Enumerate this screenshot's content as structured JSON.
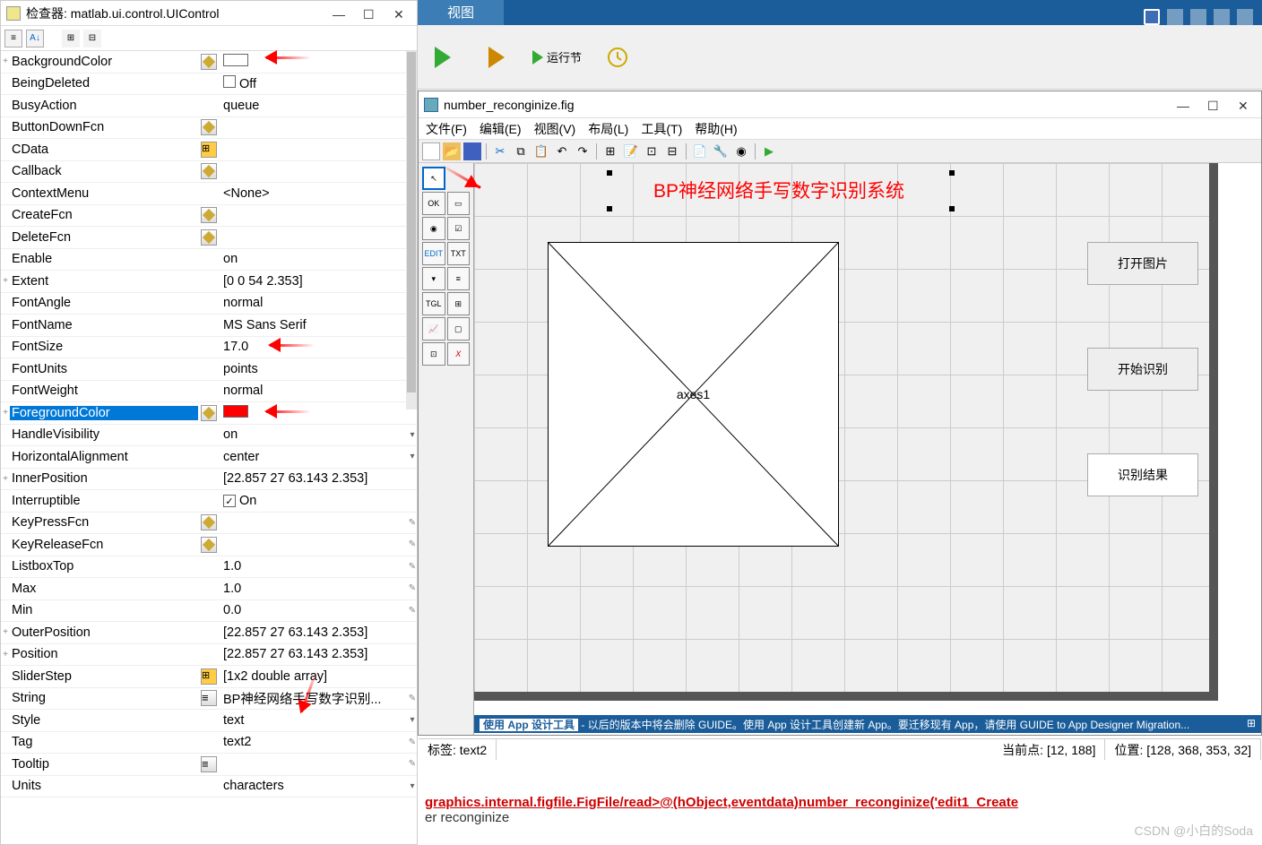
{
  "inspector": {
    "title": "检查器: matlab.ui.control.UIControl",
    "props": [
      {
        "exp": "+",
        "name": "BackgroundColor",
        "btn": "pencil",
        "val_type": "swatch-white"
      },
      {
        "name": "BeingDeleted",
        "val_type": "chk",
        "val": "Off"
      },
      {
        "name": "BusyAction",
        "val": "queue",
        "dd": true
      },
      {
        "name": "ButtonDownFcn",
        "btn": "pencil",
        "val": "",
        "edit": true
      },
      {
        "name": "CData",
        "btn": "grid",
        "val": "",
        "edit": true
      },
      {
        "name": "Callback",
        "btn": "pencil",
        "val": "",
        "edit": true
      },
      {
        "name": "ContextMenu",
        "val": "<None>",
        "dd": true
      },
      {
        "name": "CreateFcn",
        "btn": "pencil",
        "val": "",
        "edit": true
      },
      {
        "name": "DeleteFcn",
        "btn": "pencil",
        "val": "",
        "edit": true
      },
      {
        "name": "Enable",
        "val": "on",
        "dd": true
      },
      {
        "exp": "+",
        "name": "Extent",
        "val": "[0 0 54 2.353]"
      },
      {
        "name": "FontAngle",
        "val": "normal",
        "dd": true
      },
      {
        "name": "FontName",
        "val": "MS Sans Serif",
        "edit": true
      },
      {
        "name": "FontSize",
        "val": "17.0",
        "edit": true
      },
      {
        "name": "FontUnits",
        "val": "points",
        "dd": true
      },
      {
        "name": "FontWeight",
        "val": "normal",
        "dd": true
      },
      {
        "exp": "+",
        "name": "ForegroundColor",
        "btn": "pencil",
        "val_type": "swatch-red",
        "selected": true
      },
      {
        "name": "HandleVisibility",
        "val": "on",
        "dd": true
      },
      {
        "name": "HorizontalAlignment",
        "val": "center",
        "dd": true
      },
      {
        "exp": "+",
        "name": "InnerPosition",
        "val": "[22.857 27 63.143 2.353]"
      },
      {
        "name": "Interruptible",
        "val_type": "chk-on",
        "val": "On"
      },
      {
        "name": "KeyPressFcn",
        "btn": "pencil",
        "val": "",
        "edit": true
      },
      {
        "name": "KeyReleaseFcn",
        "btn": "pencil",
        "val": "",
        "edit": true
      },
      {
        "name": "ListboxTop",
        "val": "1.0",
        "edit": true
      },
      {
        "name": "Max",
        "val": "1.0",
        "edit": true
      },
      {
        "name": "Min",
        "val": "0.0",
        "edit": true
      },
      {
        "exp": "+",
        "name": "OuterPosition",
        "val": "[22.857 27 63.143 2.353]"
      },
      {
        "exp": "+",
        "name": "Position",
        "val": "[22.857 27 63.143 2.353]"
      },
      {
        "name": "SliderStep",
        "btn": "grid",
        "val": "[1x2  double array]"
      },
      {
        "name": "String",
        "btn": "list",
        "val": "BP神经网络手写数字识别...",
        "edit": true
      },
      {
        "name": "Style",
        "val": "text",
        "dd": true
      },
      {
        "name": "Tag",
        "val": "text2",
        "edit": true
      },
      {
        "name": "Tooltip",
        "btn": "list",
        "val": "",
        "edit": true
      },
      {
        "name": "Units",
        "val": "characters",
        "dd": true
      }
    ]
  },
  "ribbon": {
    "tab_view": "视图",
    "run_section": "运行节"
  },
  "guide": {
    "title": "number_reconginize.fig",
    "menu": [
      "文件(F)",
      "编辑(E)",
      "视图(V)",
      "布局(L)",
      "工具(T)",
      "帮助(H)"
    ],
    "title_text": "BP神经网络手写数字识别系统",
    "axes_label": "axes1",
    "btn1": "打开图片",
    "btn2": "开始识别",
    "edit1": "识别结果",
    "banner_bold": "使用 App 设计工具",
    "banner_text": "- 以后的版本中将会删除 GUIDE。使用 App 设计工具创建新 App。要迁移现有 App，请使用 GUIDE to App Designer Migration...",
    "status_tag": "标签: text2",
    "status_pt": "当前点: [12, 188]",
    "status_pos": "位置: [128, 368, 353, 32]"
  },
  "code": {
    "line1": "graphics.internal.figfile.FigFile/read>@(hObject,eventdata)number_reconginize('edit1_Create",
    "line2": "er reconginize",
    "watermark": "CSDN @小白的Soda"
  }
}
